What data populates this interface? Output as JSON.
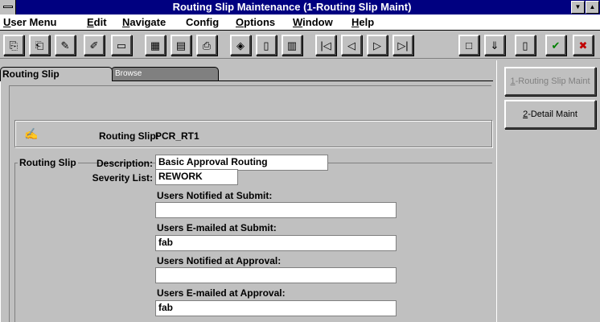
{
  "window": {
    "title": "Routing Slip Maintenance (1-Routing Slip Maint)",
    "minimize_glyph": "▼",
    "maximize_glyph": "▲"
  },
  "menu": [
    {
      "key": "U",
      "rest": "ser Menu"
    },
    {
      "key": "E",
      "rest": "dit"
    },
    {
      "key": "N",
      "rest": "avigate"
    },
    {
      "key": "",
      "rest": "Config"
    },
    {
      "key": "O",
      "rest": "ptions"
    },
    {
      "key": "W",
      "rest": "indow"
    },
    {
      "key": "H",
      "rest": "elp"
    }
  ],
  "toolbar": [
    {
      "icon": "copy-icon",
      "glyph": "⎘"
    },
    {
      "icon": "paste-icon",
      "glyph": "⎗"
    },
    {
      "icon": "paste-special-icon",
      "glyph": "✎"
    },
    {
      "icon": "edit-icon",
      "glyph": "✐"
    },
    {
      "icon": "folder-icon",
      "glyph": "▭"
    },
    {
      "icon": "calculator-icon",
      "glyph": "▦"
    },
    {
      "icon": "calendar-icon",
      "glyph": "▤"
    },
    {
      "icon": "print-icon",
      "glyph": "⎙"
    },
    {
      "icon": "network-icon",
      "glyph": "◈"
    },
    {
      "icon": "notebook-icon",
      "glyph": "▯"
    },
    {
      "icon": "chart-icon",
      "glyph": "▥"
    },
    {
      "icon": "first-record-icon",
      "glyph": "|◁"
    },
    {
      "icon": "previous-record-icon",
      "glyph": "◁"
    },
    {
      "icon": "next-record-icon",
      "glyph": "▷"
    },
    {
      "icon": "last-record-icon",
      "glyph": "▷|"
    },
    {
      "icon": "new-record-icon",
      "glyph": "□"
    },
    {
      "icon": "clear-icon",
      "glyph": "⇓"
    },
    {
      "icon": "delete-icon",
      "glyph": "▯"
    },
    {
      "icon": "accept-icon",
      "glyph": "✔"
    },
    {
      "icon": "cancel-icon",
      "glyph": "✖"
    }
  ],
  "colors": {
    "accept": "#008000",
    "cancel": "#c00000"
  },
  "tabs": {
    "routing_slip": "Routing Slip",
    "browse": "Browse"
  },
  "side_buttons": {
    "routing_slip_maint": {
      "key": "1",
      "rest": "-Routing Slip Maint"
    },
    "detail_maint": {
      "key": "2",
      "rest": "-Detail Maint"
    }
  },
  "header": {
    "label": "Routing Slip:",
    "value": "PCR_RT1"
  },
  "form": {
    "group_label": "Routing Slip",
    "description_label": "Description:",
    "description_value": "Basic Approval Routing",
    "severity_label": "Severity List:",
    "severity_value": "REWORK",
    "notified_submit_label": "Users Notified at Submit:",
    "notified_submit_value": "",
    "emailed_submit_label": "Users E-mailed at Submit:",
    "emailed_submit_value": "fab",
    "notified_approval_label": "Users Notified at Approval:",
    "notified_approval_value": "",
    "emailed_approval_label": "Users E-mailed at Approval:",
    "emailed_approval_value": "fab"
  }
}
